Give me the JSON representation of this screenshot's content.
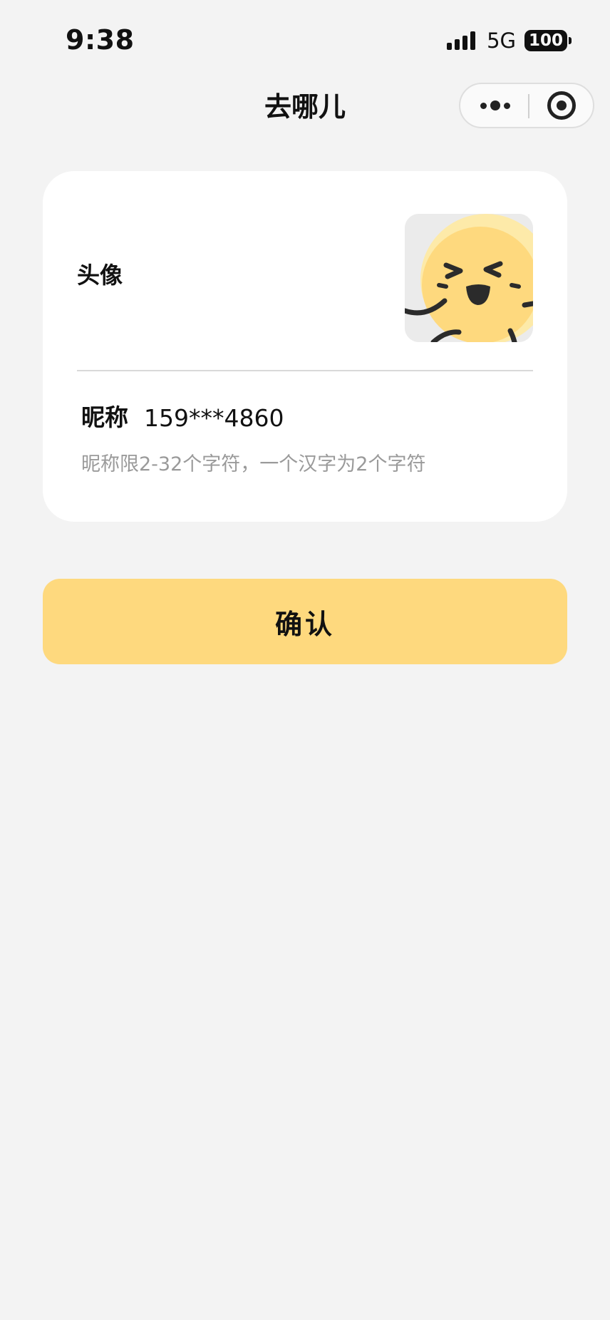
{
  "status_bar": {
    "time": "9:38",
    "network": "5G",
    "battery": "100",
    "signal_icon": "cellular-signal-icon",
    "battery_icon": "battery-icon"
  },
  "nav": {
    "title": "去哪儿",
    "more_icon": "more-dots-icon",
    "close_icon": "target-close-icon"
  },
  "profile": {
    "avatar_label": "头像",
    "avatar_image": "laughing-yellow-face-avatar",
    "nickname_label": "昵称",
    "nickname_value": "159***4860",
    "nickname_hint": "昵称限2-32个字符，一个汉字为2个字符"
  },
  "actions": {
    "confirm_label": "确认"
  },
  "colors": {
    "page_background": "#f3f3f3",
    "card_background": "#ffffff",
    "accent_yellow": "#fed97e",
    "hint_gray": "#9a9a9a"
  }
}
